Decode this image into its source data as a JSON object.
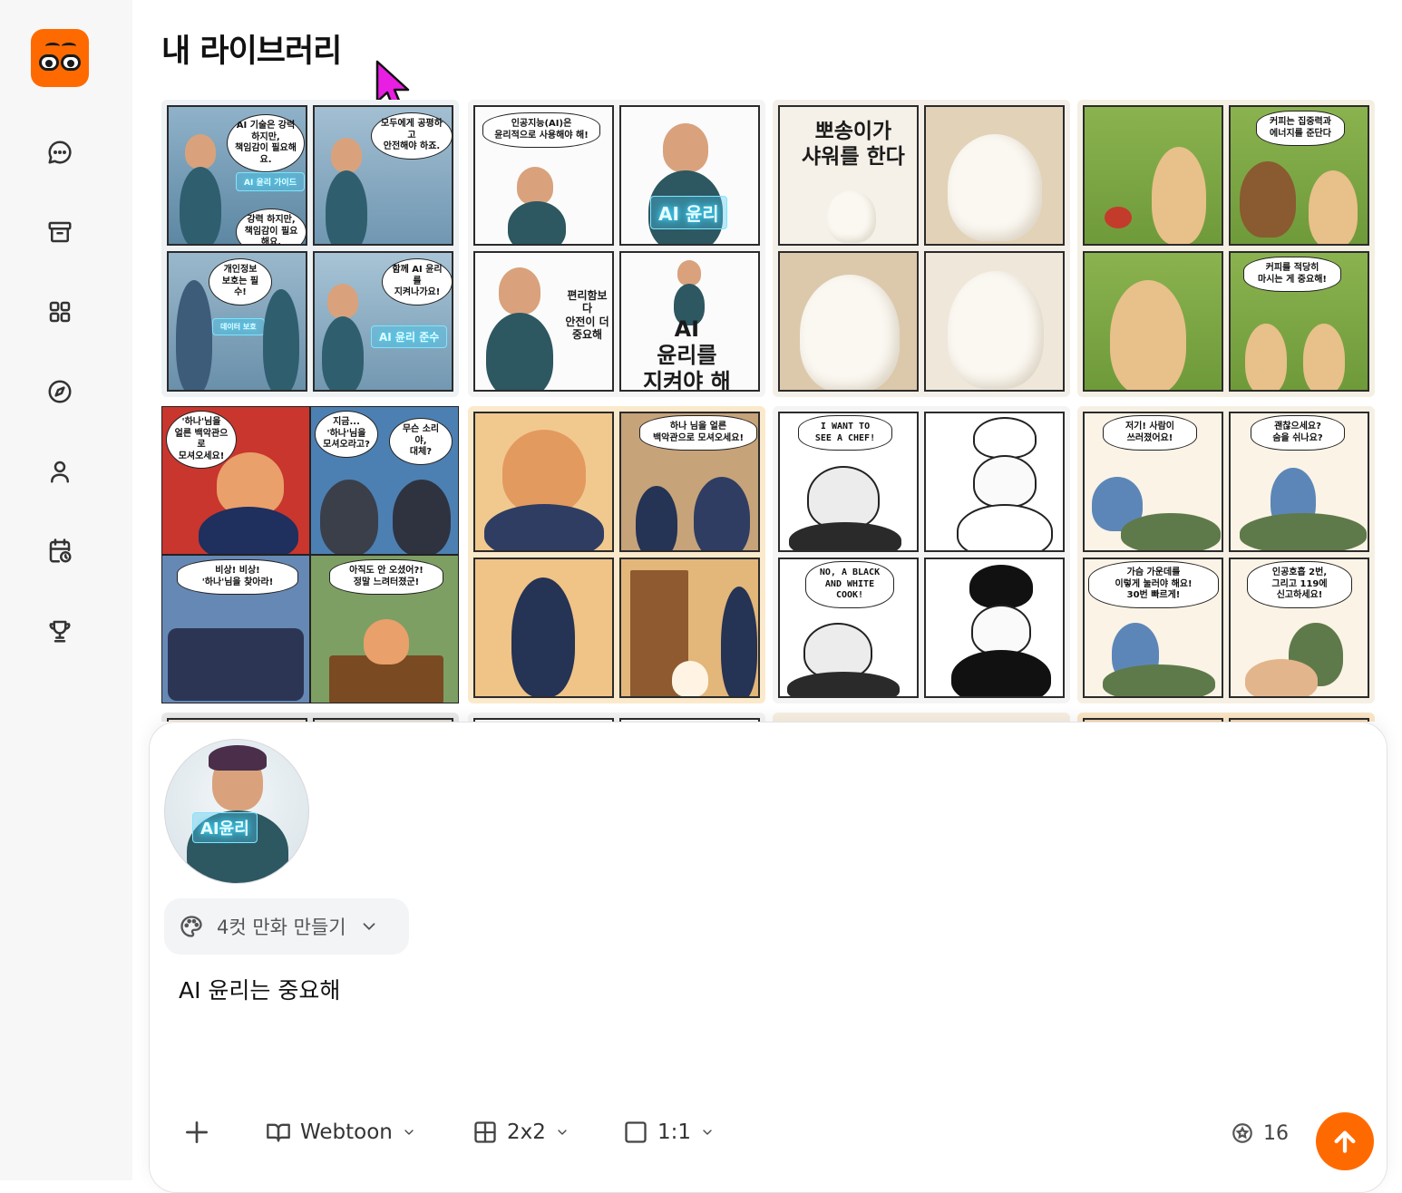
{
  "page": {
    "title": "내 라이브러리"
  },
  "colors": {
    "accent": "#ff6a00",
    "sidebar_bg": "#f7f7f8"
  },
  "sidebar": {
    "logo": "app-logo",
    "items": [
      {
        "icon": "chat-icon"
      },
      {
        "icon": "archive-icon"
      },
      {
        "icon": "grid-icon"
      },
      {
        "icon": "compass-icon"
      },
      {
        "icon": "user-icon"
      },
      {
        "icon": "calendar-clock-icon"
      },
      {
        "icon": "trophy-icon"
      }
    ]
  },
  "library": {
    "comics": [
      {
        "topic": "ai-ethics-1",
        "texts": [
          "AI 기술은 강력하지만,\n책임감이 필요해요.",
          "AI 윤리 가이드",
          "강력 하지만,\n책임감이 필요해요.",
          "모두에게 공평하고\n안전해야 하죠.",
          "개인정보\n보호는 필수!",
          "데이터 보호",
          "함께 AI 윤리를\n지켜나가요!",
          "AI 윤리 준수"
        ]
      },
      {
        "topic": "ai-ethics-2",
        "texts": [
          "인공지능(AI)은\n윤리적으로 사용해야 해!",
          "AI 윤리",
          "편리함보다\n안전이 더\n중요해",
          "AI\n윤리를\n지켜야 해"
        ]
      },
      {
        "topic": "shower",
        "texts": [
          "뽀송이가\n샤워를 한다"
        ]
      },
      {
        "topic": "coffee",
        "texts": [
          "커피는 집중력과\n에너지를 준단다",
          "커피를 적당히\n마시는 게 중요해!"
        ]
      },
      {
        "topic": "emergency-1",
        "texts": [
          "'하나'님을\n얼른 백악관으로\n모셔오세요!",
          "지금...\n'하나'님을\n모셔오라고?",
          "무슨 소리야,\n대체?",
          "비상! 비상!\n'하나'님을 찾아라!",
          "아직도 안 오셨어?!\n정말 느려터졌군!"
        ]
      },
      {
        "topic": "emergency-2",
        "texts": [
          "하나 님을 얼른\n백악관으로 모셔오세요!"
        ]
      },
      {
        "topic": "chef",
        "texts": [
          "I WANT TO\nSEE A CHEF!",
          "NO, A BLACK\nAND WHITE\nCOOK!"
        ]
      },
      {
        "topic": "cpr",
        "texts": [
          "저기! 사람이\n쓰러졌어요!",
          "괜찮으세요?\n숨을 쉬나요?",
          "가슴 가운데를\n이렇게 눌러야 해요!\n30번 빠르게!",
          "인공호흡 2번,\n그리고 119에\n신고하세요!"
        ]
      }
    ]
  },
  "composer": {
    "reference_text": "AI윤리",
    "mode_label": "4컷 만화 만들기",
    "prompt_value": "AI 윤리는 중요해",
    "toolbar": {
      "style_label": "Webtoon",
      "layout_label": "2x2",
      "ratio_label": "1:1",
      "credits": "16"
    }
  }
}
